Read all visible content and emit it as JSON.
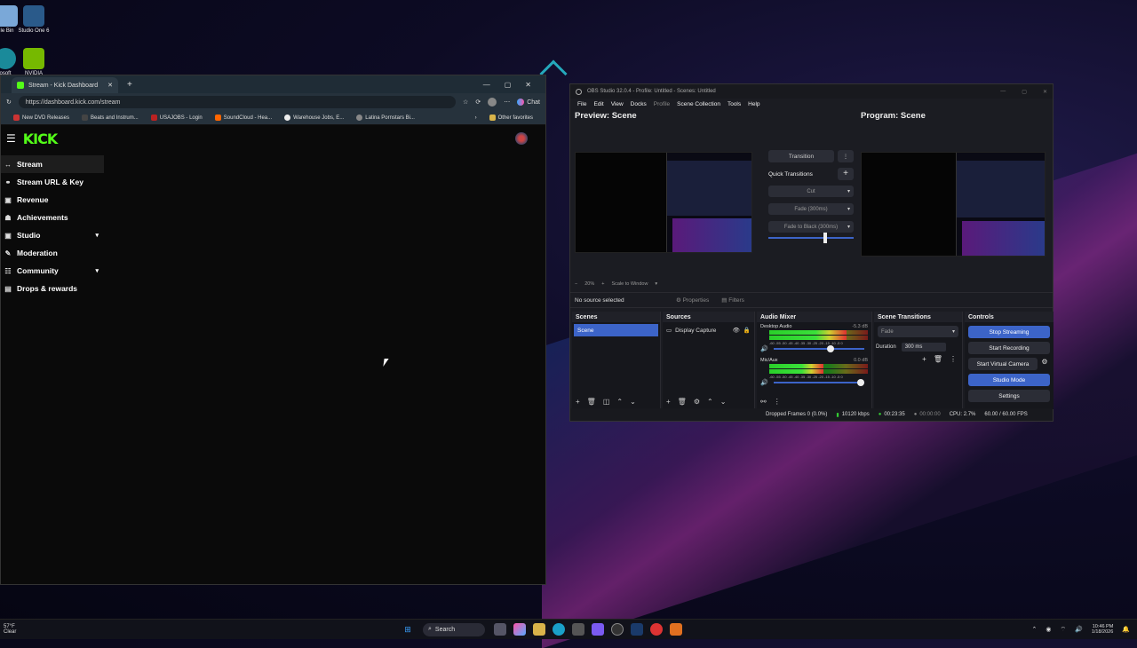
{
  "desktop": {
    "icons": [
      {
        "label": "le Bin"
      },
      {
        "label": "Studio One 6"
      },
      {
        "label": "osoft"
      },
      {
        "label": "NVIDIA"
      }
    ]
  },
  "browser": {
    "tab_title": "Stream - Kick Dashboard",
    "url": "https://dashboard.kick.com/stream",
    "chat_label": "Chat",
    "bookmarks": [
      "New DVD Releases",
      "Beats and Instrum...",
      "USAJOBS - Login",
      "SoundCloud - Hea...",
      "Warehouse Jobs, E...",
      "Latina Pornstars Bi..."
    ],
    "other_favorites": "Other favorites",
    "logo": "KICK",
    "nav": [
      {
        "label": "Stream",
        "icon": "↔"
      },
      {
        "label": "Stream URL & Key",
        "icon": "🔗"
      },
      {
        "label": "Revenue",
        "icon": "▣"
      },
      {
        "label": "Achievements",
        "icon": "☗"
      },
      {
        "label": "Studio",
        "icon": "▣",
        "chevron": "▾"
      },
      {
        "label": "Moderation",
        "icon": "✎"
      },
      {
        "label": "Community",
        "icon": "☷",
        "chevron": "▾"
      },
      {
        "label": "Drops & rewards",
        "icon": "▤"
      }
    ]
  },
  "obs": {
    "title": "OBS Studio 32.0.4 - Profile: Untitled - Scenes: Untitled",
    "menu": [
      "File",
      "Edit",
      "View",
      "Docks",
      "Profile",
      "Scene Collection",
      "Tools",
      "Help"
    ],
    "preview_label": "Preview: Scene",
    "program_label": "Program: Scene",
    "transition_btn": "Transition",
    "quick_transitions": "Quick Transitions",
    "qt_options": [
      "Cut",
      "Fade (300ms)",
      "Fade to Black (300ms)"
    ],
    "zoom": "20%",
    "scale_label": "Scale to Window",
    "no_source": "No source selected",
    "properties": "Properties",
    "filters": "Filters",
    "scenes_title": "Scenes",
    "scene_item": "Scene",
    "sources_title": "Sources",
    "source_item": "Display Capture",
    "mixer_title": "Audio Mixer",
    "mixer": [
      {
        "name": "Desktop Audio",
        "db": "-5.3 dB",
        "level": 0.78
      },
      {
        "name": "Mic/Aux",
        "db": "0.0 dB",
        "level": 0.55
      }
    ],
    "meter_scale": "-60 -55 -50 -45 -40 -35 -30 -25 -20 -15 -10 -5 0",
    "scene_transitions_title": "Scene Transitions",
    "transition_select": "Fade",
    "duration_label": "Duration",
    "duration_value": "300 ms",
    "controls_title": "Controls",
    "controls": [
      "Stop Streaming",
      "Start Recording",
      "Start Virtual Camera",
      "Studio Mode",
      "Settings"
    ],
    "status": {
      "dropped": "Dropped Frames 0 (0.0%)",
      "kbps": "10120 kbps",
      "stream_time": "00:23:35",
      "rec_time": "00:00:00",
      "cpu": "CPU: 2.7%",
      "fps": "60.00 / 60.00 FPS"
    }
  },
  "taskbar": {
    "weather_temp": "57°F",
    "weather_desc": "Clear",
    "search": "Search",
    "time": "10:46 PM",
    "date": "1/18/2026"
  },
  "colors": {
    "kick_green": "#53fc18",
    "obs_blue": "#3c64c8"
  }
}
